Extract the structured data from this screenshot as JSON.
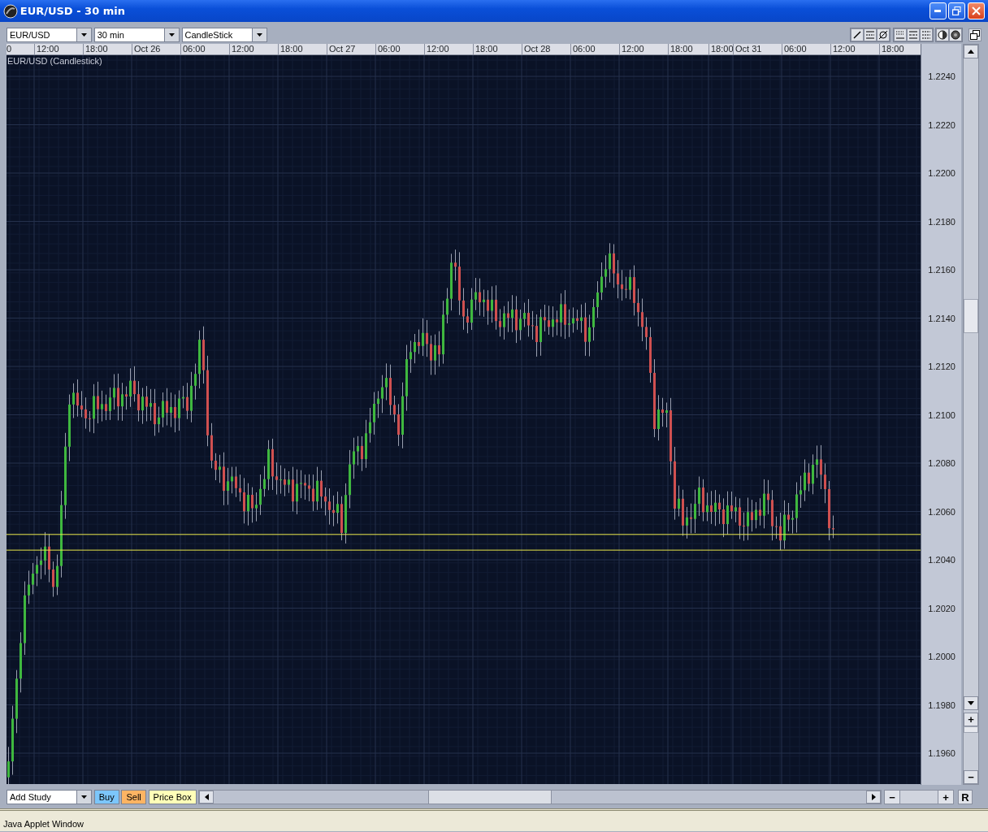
{
  "window": {
    "title": "EUR/USD - 30 min"
  },
  "toolbar": {
    "symbol": "EUR/USD",
    "interval": "30 min",
    "chart_type": "CandleStick"
  },
  "chart": {
    "series_label": "EUR/USD (Candlestick)",
    "time_axis": [
      "0",
      "12:00",
      "18:00",
      "Oct 26",
      "06:00",
      "12:00",
      "18:00",
      "Oct 27",
      "06:00",
      "12:00",
      "18:00",
      "Oct 28",
      "06:00",
      "12:00",
      "18:00",
      "18:00",
      "Oct 31",
      "06:00",
      "12:00",
      "18:00"
    ],
    "price_axis": [
      "1.2240",
      "1.2220",
      "1.2200",
      "1.2180",
      "1.2160",
      "1.2140",
      "1.2120",
      "1.2100",
      "1.2080",
      "1.2060",
      "1.2040",
      "1.2020",
      "1.2000",
      "1.1980",
      "1.1960"
    ],
    "zoom_in": "+",
    "zoom_out": "−"
  },
  "bottom_bar": {
    "study": "Add Study",
    "buttons": [
      {
        "label": "Buy",
        "kind": "buy"
      },
      {
        "label": "Sell",
        "kind": "sell"
      },
      {
        "label": "Price Box",
        "kind": "pricebox"
      }
    ],
    "zoom_out": "−",
    "zoom_in": "+",
    "reset": "R"
  },
  "status_bar": "Java Applet Window"
}
